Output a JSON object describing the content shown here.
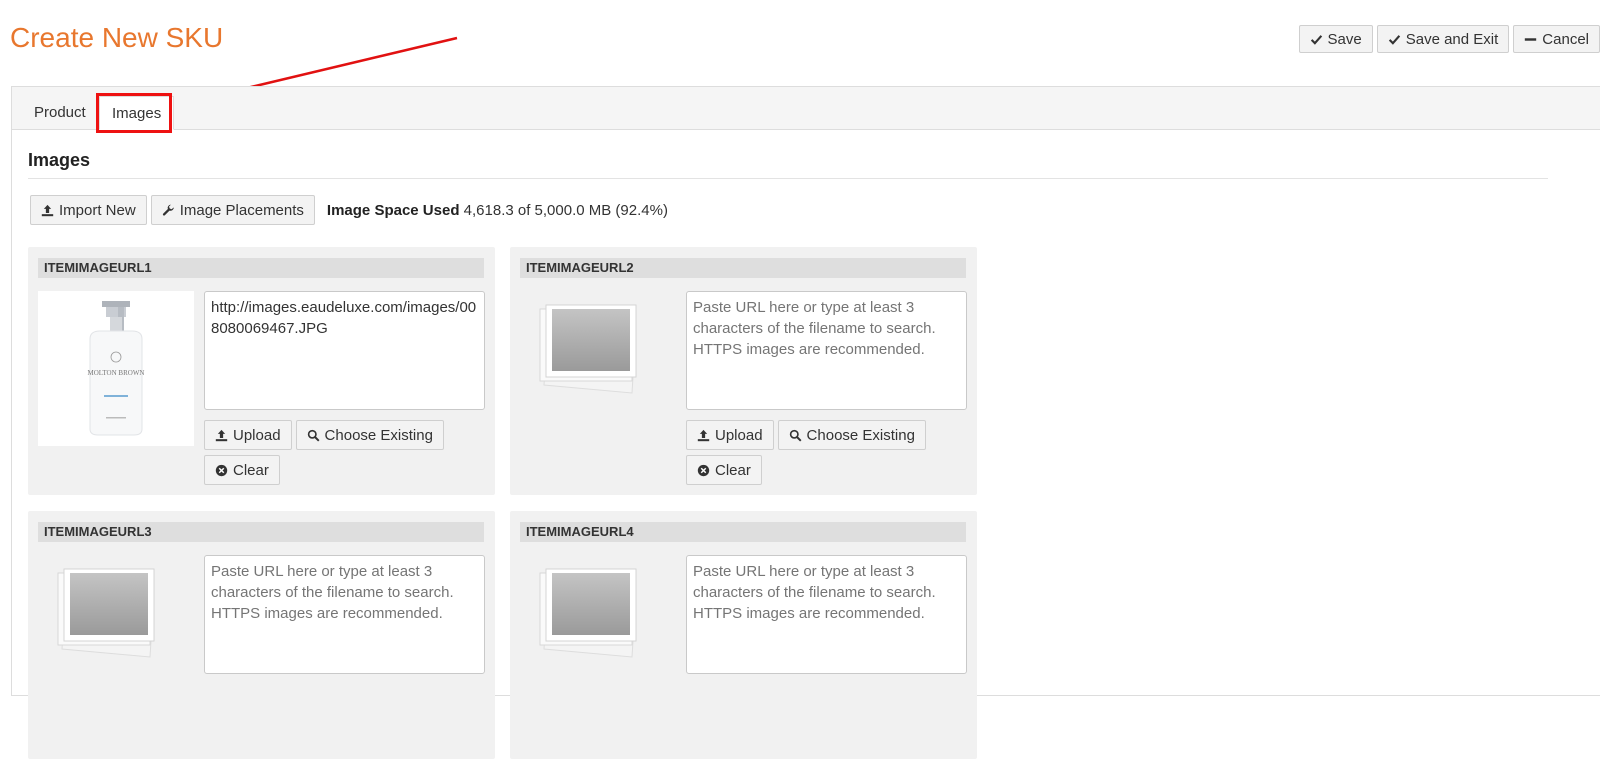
{
  "page": {
    "title": "Create New SKU",
    "accent_color": "#e8772e",
    "annotation_color": "#e11111"
  },
  "actions": {
    "save": "Save",
    "save_exit": "Save and Exit",
    "cancel": "Cancel"
  },
  "tabs": [
    {
      "label": "Product",
      "active": false
    },
    {
      "label": "Images",
      "active": true
    }
  ],
  "section": {
    "title": "Images"
  },
  "toolbar": {
    "import_new": "Import New",
    "image_placements": "Image Placements",
    "space_label": "Image Space Used",
    "space_value": "4,618.3 of 5,000.0 MB (92.4%)"
  },
  "cards": [
    {
      "name": "ITEMIMAGEURL1",
      "url": "http://images.eaudeluxe.com/images/008080069467.JPG",
      "placeholder": "Paste URL here or type at least 3 characters of the filename to search. HTTPS images are recommended.",
      "has_image": true,
      "upload": "Upload",
      "choose": "Choose Existing",
      "clear": "Clear"
    },
    {
      "name": "ITEMIMAGEURL2",
      "url": "",
      "placeholder": "Paste URL here or type at least 3 characters of the filename to search. HTTPS images are recommended.",
      "has_image": false,
      "upload": "Upload",
      "choose": "Choose Existing",
      "clear": "Clear"
    },
    {
      "name": "ITEMIMAGEURL3",
      "url": "",
      "placeholder": "Paste URL here or type at least 3 characters of the filename to search. HTTPS images are recommended.",
      "has_image": false
    },
    {
      "name": "ITEMIMAGEURL4",
      "url": "",
      "placeholder": "Paste URL here or type at least 3 characters of the filename to search. HTTPS images are recommended.",
      "has_image": false
    }
  ],
  "product_image": {
    "brand_text": "MOLTON BROWN"
  }
}
